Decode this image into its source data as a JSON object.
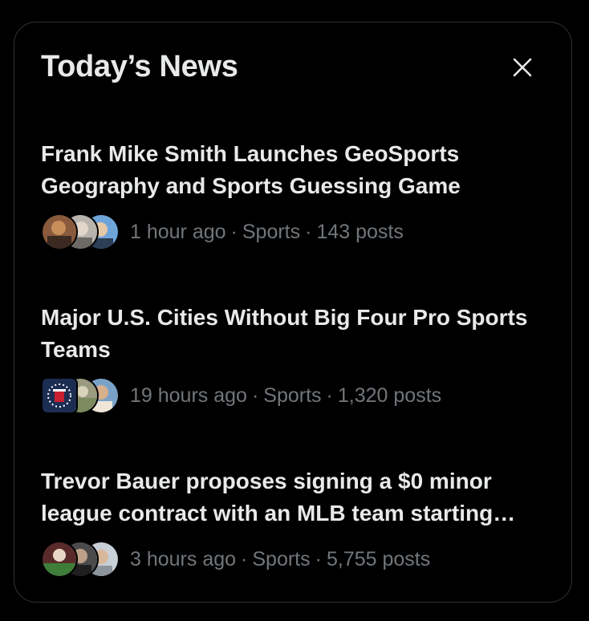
{
  "panel": {
    "title": "Today’s News",
    "close_icon": "close-icon"
  },
  "stories": [
    {
      "headline": "Frank Mike Smith Launches GeoSports Geography and Sports Guessing Game",
      "time": "1 hour ago",
      "category": "Sports",
      "posts": "143 posts"
    },
    {
      "headline": "Major U.S. Cities Without Big Four Pro Sports Teams",
      "time": "19 hours ago",
      "category": "Sports",
      "posts": "1,320 posts"
    },
    {
      "headline": "Trevor Bauer proposes signing a $0 minor league contract with an MLB team starting…",
      "time": "3 hours ago",
      "category": "Sports",
      "posts": "5,755 posts"
    }
  ],
  "separator": "·",
  "colors": {
    "background": "#000000",
    "border": "#2f3336",
    "primary_text": "#e7e9ea",
    "secondary_text": "#71767b"
  }
}
